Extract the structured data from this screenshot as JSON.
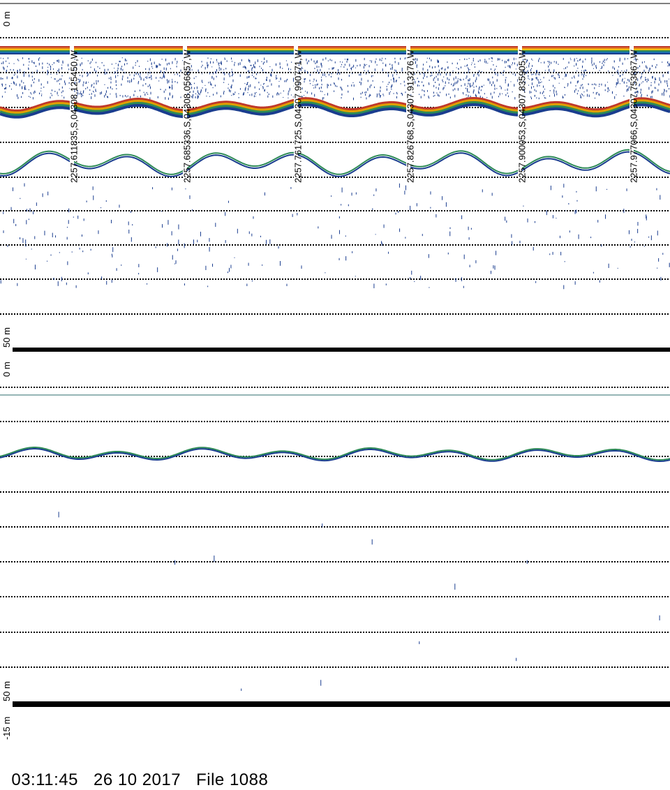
{
  "panels": [
    {
      "name": "upper-echogram",
      "top_label": "0 m",
      "bottom_label": "50 m",
      "colorful": true
    },
    {
      "name": "lower-echogram",
      "top_label": "0 m",
      "bottom_label": "50 m",
      "extra_label": "-15 m",
      "colorful": false
    }
  ],
  "position_labels": [
    "2257.611835,S,04308.125450,W",
    "2257.685336,S,04308.056857,W",
    "2257.761725,S,04307.990771,W",
    "2257.826768,S,04307.913276,W",
    "2257.900053,S,04307.835905,W",
    "2257.977066,S,04307.753867,W"
  ],
  "footer": {
    "time": "03:11:45",
    "date": "26 10 2017",
    "file": "File 1088"
  },
  "colors": {
    "grid": "#000000",
    "signal_deep": "#1a3d8f",
    "signal_mid": "#2e8b57",
    "signal_warm": "#e0a000",
    "signal_hot": "#c0392b"
  }
}
